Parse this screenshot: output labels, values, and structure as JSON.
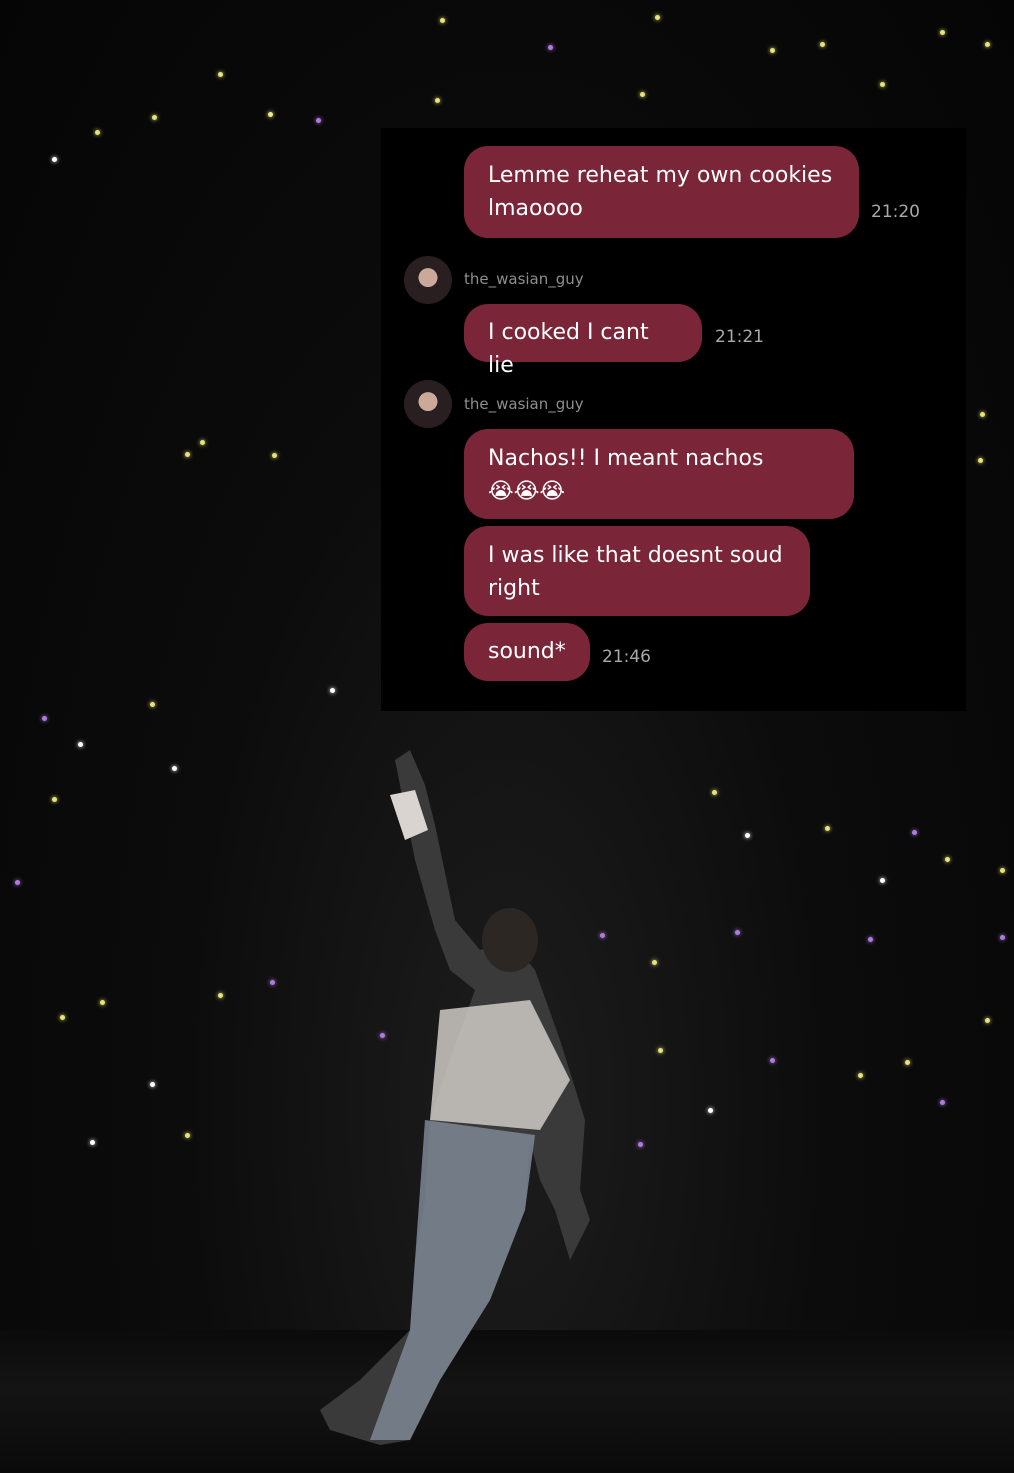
{
  "chat": {
    "messages": [
      {
        "text": "Lemme reheat my own cookies lmaoooo",
        "time": "21:20"
      },
      {
        "sender": "the_wasian_guy",
        "text": "I cooked I cant lie",
        "time": "21:21"
      },
      {
        "sender": "the_wasian_guy",
        "text": "Nachos!! I meant nachos😭😭😭"
      },
      {
        "text": "I was like that doesnt soud right"
      },
      {
        "text": "sound*",
        "time": "21:46"
      }
    ]
  },
  "colors": {
    "bubble": "#7a2538",
    "panel": "#000000",
    "timestamp": "#a9a9a9",
    "username": "#8e8e8e"
  }
}
